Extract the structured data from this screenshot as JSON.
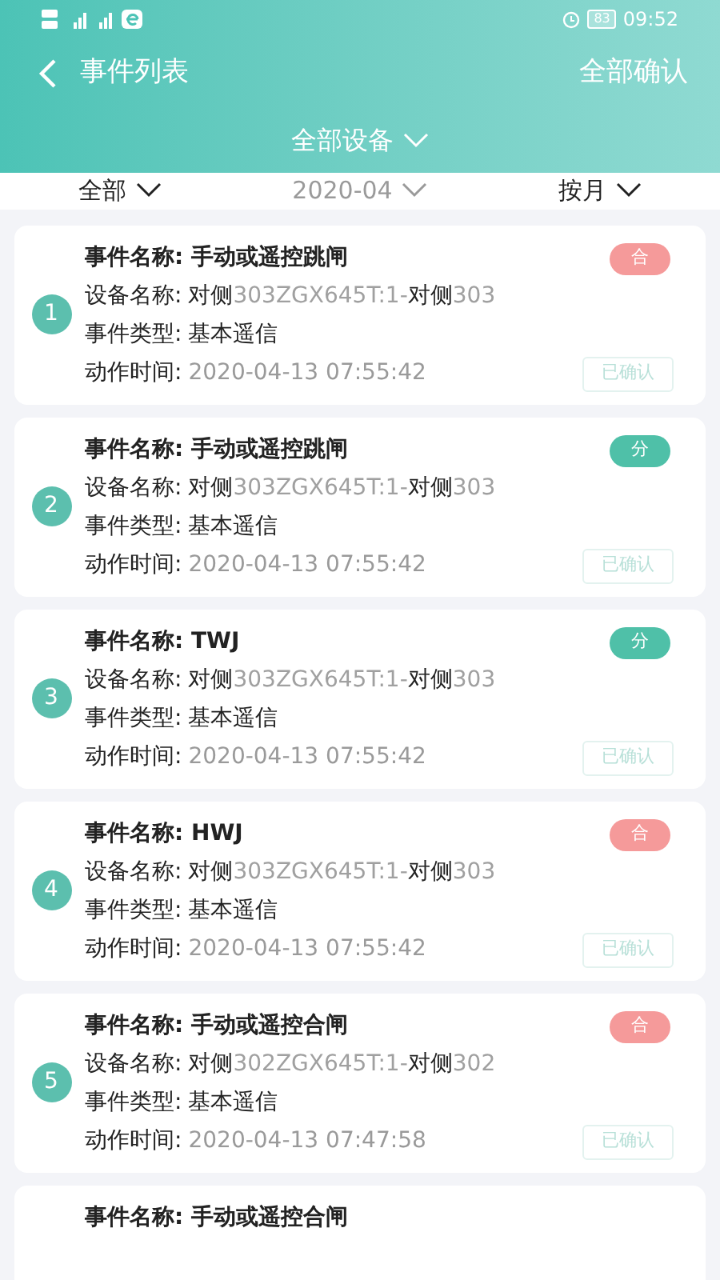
{
  "status_bar": {
    "time": "09:52",
    "battery": "83"
  },
  "header": {
    "title": "事件列表",
    "action": "全部确认",
    "device_filter": "全部设备"
  },
  "filters": [
    {
      "label": "全部",
      "dim": false
    },
    {
      "label": "2020-04",
      "dim": true
    },
    {
      "label": "按月",
      "dim": false
    }
  ],
  "events": [
    {
      "index": "1",
      "title": "事件名称: 手动或遥控跳闸",
      "device_label": "设备名称:",
      "device": [
        {
          "text": "对侧",
          "dim": false
        },
        {
          "text": "303ZGX645T:1-",
          "dim": true
        },
        {
          "text": "对侧",
          "dim": false
        },
        {
          "text": "303",
          "dim": true
        }
      ],
      "type_label": "事件类型:",
      "type": "基本遥信",
      "time_label": "动作时间:",
      "time": "2020-04-13 07:55:42",
      "badge": "合",
      "color": "#f59a9a",
      "confirm": "已确认"
    },
    {
      "index": "2",
      "title": "事件名称: 手动或遥控跳闸",
      "device_label": "设备名称:",
      "device": [
        {
          "text": "对侧",
          "dim": false
        },
        {
          "text": "303ZGX645T:1-",
          "dim": true
        },
        {
          "text": "对侧",
          "dim": false
        },
        {
          "text": "303",
          "dim": true
        }
      ],
      "type_label": "事件类型:",
      "type": "基本遥信",
      "time_label": "动作时间:",
      "time": "2020-04-13 07:55:42",
      "badge": "分",
      "color": "#4fc0a8",
      "confirm": "已确认"
    },
    {
      "index": "3",
      "title": "事件名称: TWJ",
      "device_label": "设备名称:",
      "device": [
        {
          "text": "对侧",
          "dim": false
        },
        {
          "text": "303ZGX645T:1-",
          "dim": true
        },
        {
          "text": "对侧",
          "dim": false
        },
        {
          "text": "303",
          "dim": true
        }
      ],
      "type_label": "事件类型:",
      "type": "基本遥信",
      "time_label": "动作时间:",
      "time": "2020-04-13 07:55:42",
      "badge": "分",
      "color": "#4fc0a8",
      "confirm": "已确认"
    },
    {
      "index": "4",
      "title": "事件名称: HWJ",
      "device_label": "设备名称:",
      "device": [
        {
          "text": "对侧",
          "dim": false
        },
        {
          "text": "303ZGX645T:1-",
          "dim": true
        },
        {
          "text": "对侧",
          "dim": false
        },
        {
          "text": "303",
          "dim": true
        }
      ],
      "type_label": "事件类型:",
      "type": "基本遥信",
      "time_label": "动作时间:",
      "time": "2020-04-13 07:55:42",
      "badge": "合",
      "color": "#f59a9a",
      "confirm": "已确认"
    },
    {
      "index": "5",
      "title": "事件名称: 手动或遥控合闸",
      "device_label": "设备名称:",
      "device": [
        {
          "text": "对侧",
          "dim": false
        },
        {
          "text": "302ZGX645T:1-",
          "dim": true
        },
        {
          "text": "对侧",
          "dim": false
        },
        {
          "text": "302",
          "dim": true
        }
      ],
      "type_label": "事件类型:",
      "type": "基本遥信",
      "time_label": "动作时间:",
      "time": "2020-04-13 07:47:58",
      "badge": "合",
      "color": "#f59a9a",
      "confirm": "已确认"
    },
    {
      "title": "事件名称: 手动或遥控合闸"
    }
  ]
}
